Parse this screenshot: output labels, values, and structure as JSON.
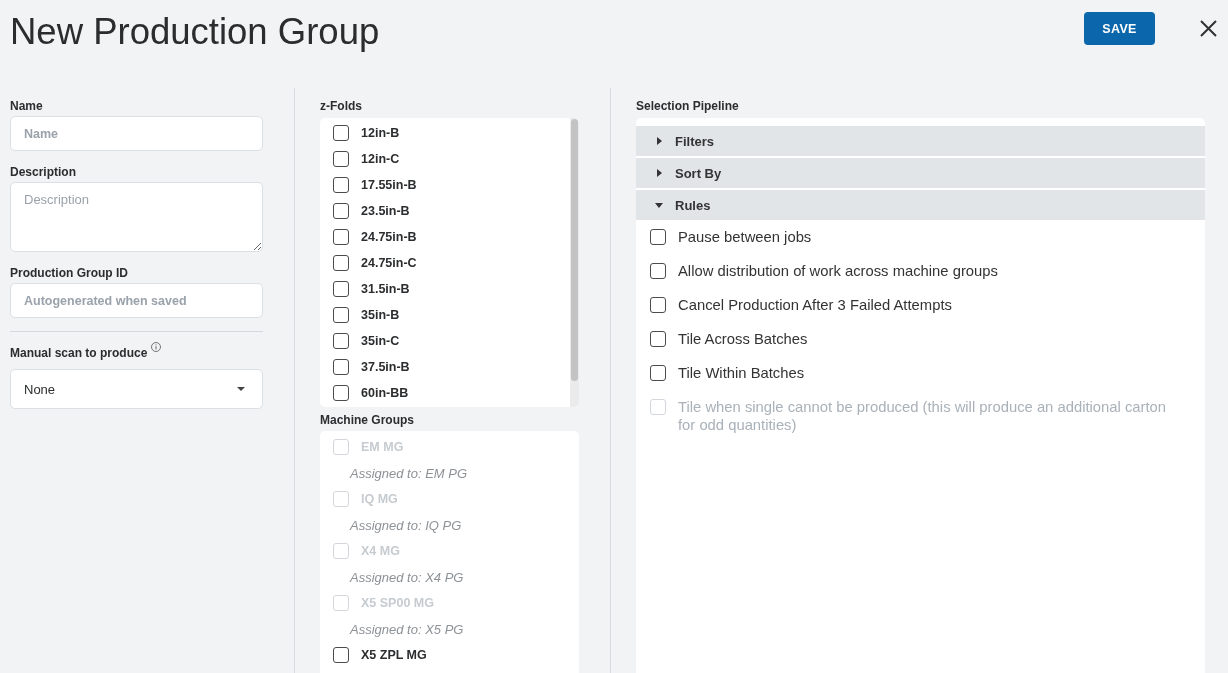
{
  "header": {
    "title": "New Production Group",
    "save_label": "SAVE"
  },
  "details": {
    "fields": [
      {
        "kind": "input",
        "label": "Name",
        "placeholder": "Name"
      },
      {
        "kind": "textarea",
        "label": "Description",
        "placeholder": "Description"
      },
      {
        "kind": "input",
        "label": "Production Group ID",
        "placeholder": "Autogenerated when saved"
      }
    ],
    "manual_scan": {
      "label": "Manual scan to produce",
      "value": "None"
    }
  },
  "z_folds": {
    "label": "z-Folds",
    "items": [
      {
        "label": "12in-B",
        "checked": false
      },
      {
        "label": "12in-C",
        "checked": false
      },
      {
        "label": "17.55in-B",
        "checked": false
      },
      {
        "label": "23.5in-B",
        "checked": false
      },
      {
        "label": "24.75in-B",
        "checked": false
      },
      {
        "label": "24.75in-C",
        "checked": false
      },
      {
        "label": "31.5in-B",
        "checked": false
      },
      {
        "label": "35in-B",
        "checked": false
      },
      {
        "label": "35in-C",
        "checked": false
      },
      {
        "label": "37.5in-B",
        "checked": false
      },
      {
        "label": "60in-BB",
        "checked": false
      }
    ]
  },
  "machine_groups": {
    "label": "Machine Groups",
    "items": [
      {
        "label": "EM MG",
        "checked": false,
        "disabled": true,
        "assigned": "Assigned to: EM PG"
      },
      {
        "label": "IQ MG",
        "checked": false,
        "disabled": true,
        "assigned": "Assigned to: IQ PG"
      },
      {
        "label": "X4 MG",
        "checked": false,
        "disabled": true,
        "assigned": "Assigned to: X4 PG"
      },
      {
        "label": "X5 SP00 MG",
        "checked": false,
        "disabled": true,
        "assigned": "Assigned to: X5 PG"
      },
      {
        "label": "X5 ZPL MG",
        "checked": false,
        "disabled": false
      }
    ]
  },
  "selection_pipeline": {
    "label": "Selection Pipeline",
    "sections": [
      {
        "label": "Filters",
        "expanded": false
      },
      {
        "label": "Sort By",
        "expanded": false
      },
      {
        "label": "Rules",
        "expanded": true,
        "items": [
          {
            "label": "Pause between jobs",
            "checked": false,
            "disabled": false
          },
          {
            "label": "Allow distribution of work across machine groups",
            "checked": false,
            "disabled": false
          },
          {
            "label": "Cancel Production After 3 Failed Attempts",
            "checked": false,
            "disabled": false
          },
          {
            "label": "Tile Across Batches",
            "checked": false,
            "disabled": false
          },
          {
            "label": "Tile Within Batches",
            "checked": false,
            "disabled": false
          },
          {
            "label": "Tile when single cannot be produced (this will produce an additional carton for odd quantities)",
            "checked": false,
            "disabled": true
          }
        ]
      }
    ]
  }
}
